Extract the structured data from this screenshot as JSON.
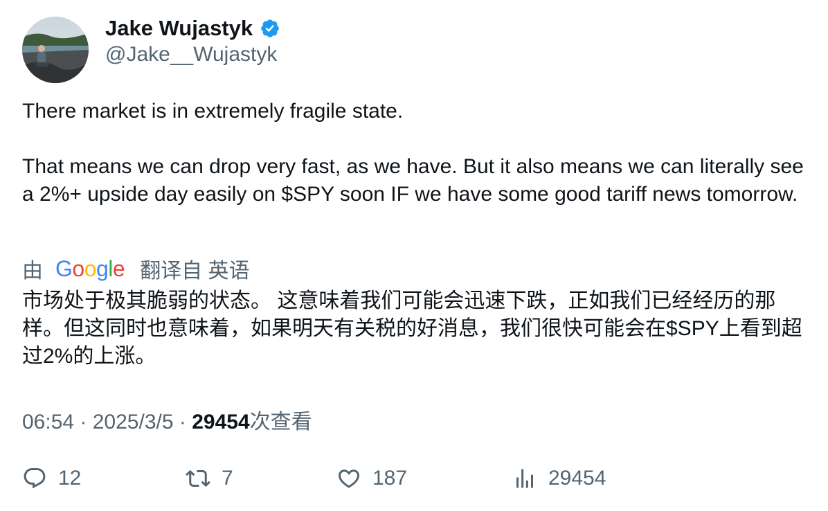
{
  "author": {
    "display_name": "Jake Wujastyk",
    "handle": "@Jake__Wujastyk",
    "verified": true,
    "avatar_icon": "profile-photo"
  },
  "tweet": {
    "paragraph_1": "There market is in extremely fragile state.",
    "paragraph_2": "That means we can drop very fast, as we have. But it also means we can literally see a 2%+ upside day easily on $SPY soon IF we have some good tariff news tomorrow."
  },
  "translation": {
    "prefix": "由",
    "provider_letters": [
      "G",
      "o",
      "o",
      "g",
      "l",
      "e"
    ],
    "provider_colors": [
      "#4285F4",
      "#EA4335",
      "#FBBC05",
      "#4285F4",
      "#34A853",
      "#EA4335"
    ],
    "label": "翻译自 英语",
    "text": "市场处于极其脆弱的状态。 这意味着我们可能会迅速下跌，正如我们已经经历的那样。但这同时也意味着，如果明天有关税的好消息，我们很快可能会在$SPY上看到超过2%的上涨。"
  },
  "meta": {
    "time": "06:54",
    "separator_1": " · ",
    "date": "2025/3/5",
    "separator_2": " · ",
    "views_count": "29454",
    "views_label": "次查看"
  },
  "actions": {
    "replies": "12",
    "retweets": "7",
    "likes": "187",
    "views": "29454"
  },
  "colors": {
    "text_primary": "#0f1419",
    "text_secondary": "#536471",
    "verified_blue": "#1d9bf0"
  }
}
